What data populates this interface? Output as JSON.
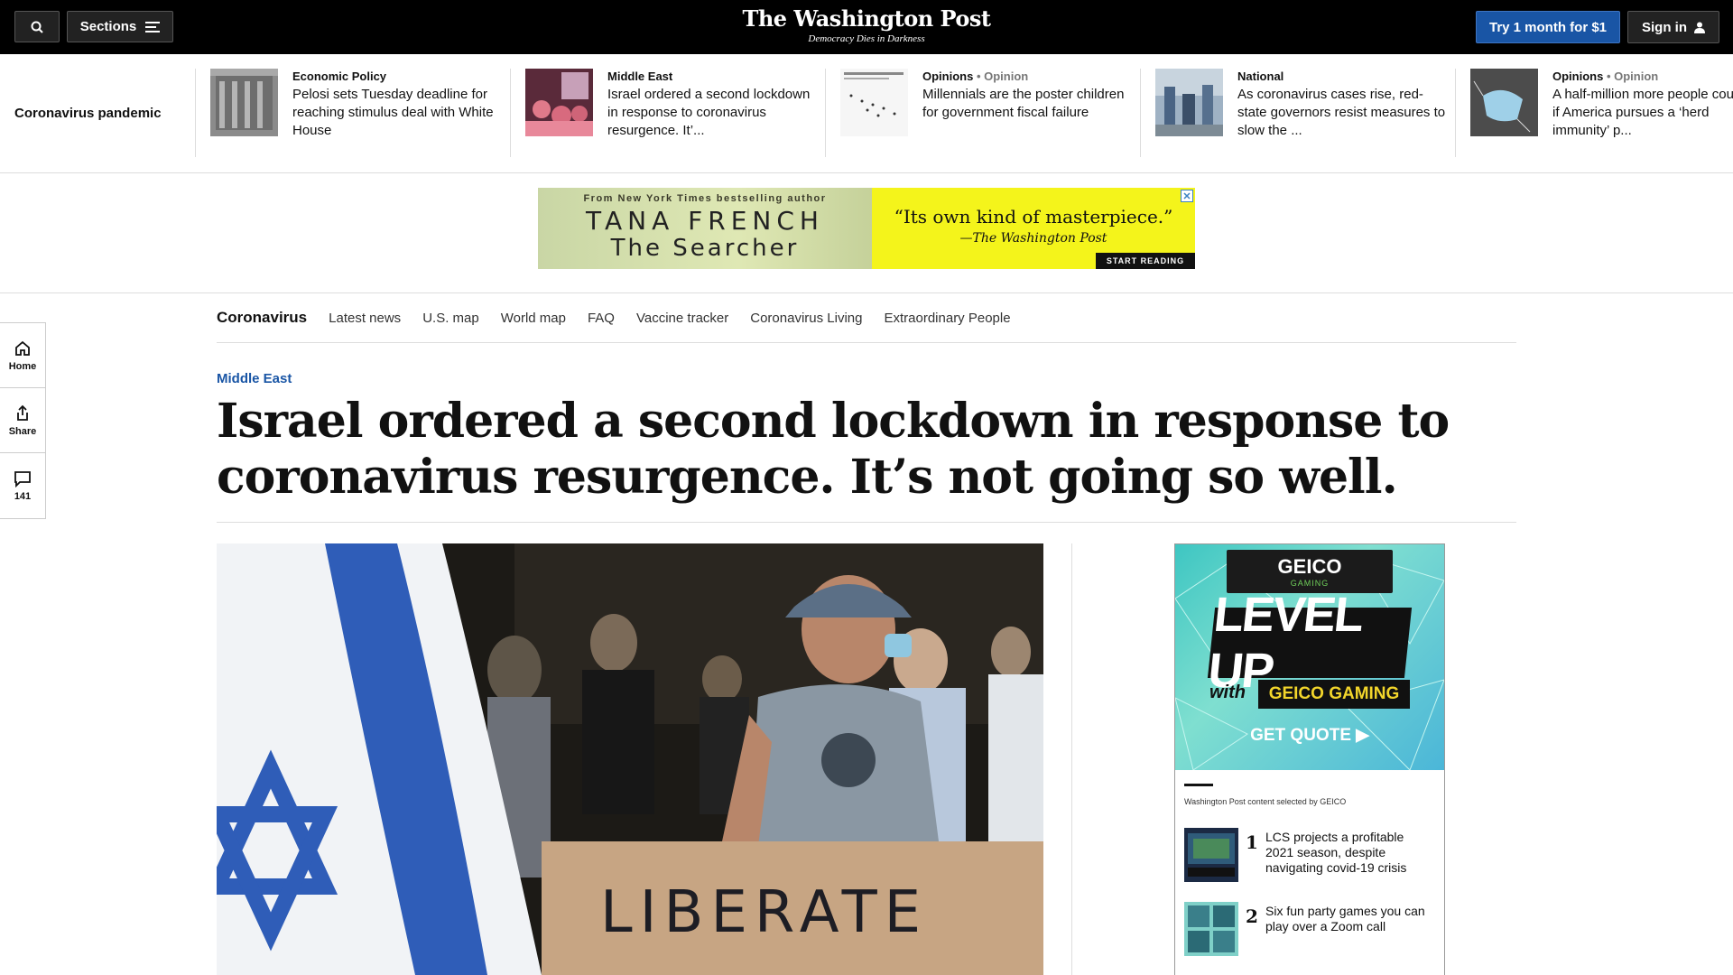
{
  "header": {
    "sections_label": "Sections",
    "logo_name": "The Washington Post",
    "tagline": "Democracy Dies in Darkness",
    "try_label": "Try 1 month for $1",
    "signin_label": "Sign in"
  },
  "trending": {
    "label": "Coronavirus pandemic",
    "cards": [
      {
        "kicker": "Economic Policy",
        "opinion": "",
        "headline": "Pelosi sets Tuesday deadline for reaching stimulus deal with White House"
      },
      {
        "kicker": "Middle East",
        "opinion": "",
        "headline": "Israel ordered a second lockdown in response to coronavirus resurgence. It’..."
      },
      {
        "kicker": "Opinions",
        "opinion": "• Opinion",
        "headline": "Millennials are the poster children for government fiscal failure"
      },
      {
        "kicker": "National",
        "opinion": "",
        "headline": "As coronavirus cases rise, red-state governors resist measures to slow the ..."
      },
      {
        "kicker": "Opinions",
        "opinion": "• Opinion",
        "headline": "A half-million more people cou die if America pursues a ‘herd immunity’ p..."
      }
    ]
  },
  "top_ad": {
    "from_text": "From New York Times bestselling author",
    "author": "TANA FRENCH",
    "book": "The Searcher",
    "quote": "“Its own kind of masterpiece.”",
    "source": "—The Washington Post",
    "cta": "START READING",
    "close": "✕"
  },
  "rail": {
    "home": "Home",
    "share": "Share",
    "comments": "141"
  },
  "subnav": {
    "title": "Coronavirus",
    "links": [
      "Latest news",
      "U.S. map",
      "World map",
      "FAQ",
      "Vaccine tracker",
      "Coronavirus Living",
      "Extraordinary People"
    ]
  },
  "article": {
    "kicker": "Middle East",
    "headline": "Israel ordered a second lockdown in response to coronavirus resurgence. It’s not going so well.",
    "photo_sign_text": "LIBERATE"
  },
  "side_ad": {
    "logo": "GEICO",
    "logo_sub": "GAMING",
    "level_up": "LEVEL UP",
    "with": "with",
    "geico_gaming": "GEICO GAMING",
    "get_quote": "GET QUOTE ▶",
    "selected_by": "Washington Post content selected by GEICO",
    "items": [
      {
        "num": "1",
        "title": "LCS projects a profitable 2021 season, despite navigating covid-19 crisis"
      },
      {
        "num": "2",
        "title": "Six fun party games you can play over a Zoom call"
      }
    ]
  },
  "colors": {
    "accent_blue": "#1955a5",
    "header_bg": "#000000",
    "ad_yellow": "#f4f41b"
  }
}
